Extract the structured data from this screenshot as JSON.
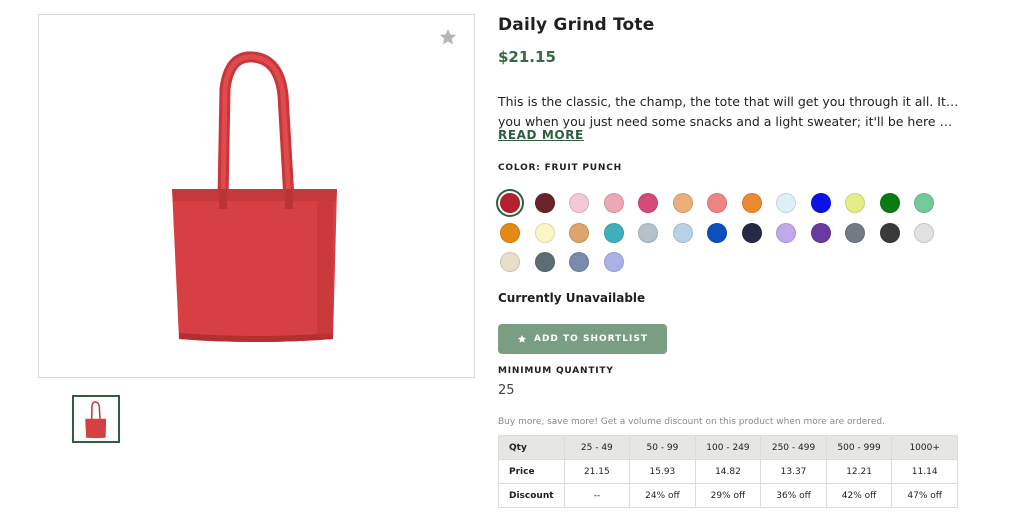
{
  "product": {
    "title": "Daily Grind Tote",
    "price": "$21.15",
    "description_lines": [
      "This is the classic, the champ, the tote that will get you through it all. It'll be here for",
      "you when you just need some snacks and a light sweater; it'll be here when you hav..."
    ],
    "read_more_label": "READ MORE",
    "color_label": "COLOR: FRUIT PUNCH",
    "favorite_icon": "star-icon",
    "product_color": "#d43c40",
    "swatches": [
      "#b5212f",
      "#6b2229",
      "#f5c8d6",
      "#eea8b4",
      "#d44a78",
      "#eab078",
      "#ef8484",
      "#ec8a2e",
      "#dff1f8",
      "#0a12e8",
      "#e3ef86",
      "#0a7a12",
      "#74c99a",
      "#e58a14",
      "#fbf6c6",
      "#dda46c",
      "#3db0bc",
      "#b4c2cc",
      "#b8d2ea",
      "#0c4ebe",
      "#262a46",
      "#c2a8ea",
      "#6a3aa0",
      "#727c86",
      "#3a3a3a",
      "#e2e2e2",
      "#e8e0c6",
      "#5c6e74",
      "#7a8aac",
      "#a8b2e6"
    ],
    "selected_swatch": 0,
    "availability": "Currently Unavailable",
    "shortlist_label": "ADD TO SHORTLIST",
    "shortlist_icon": "star-icon",
    "button_color": "#7a9e82",
    "min_quantity_label": "MINIMUM QUANTITY",
    "min_quantity_value": "25",
    "volume_note": "Buy more, save more! Get a volume discount on this product when more are ordered.",
    "accent_color": "#2f6b43"
  },
  "pricing_table": {
    "headers": [
      "Qty",
      "25 - 49",
      "50 - 99",
      "100 - 249",
      "250 - 499",
      "500 - 999",
      "1000+"
    ],
    "rows": [
      [
        "Price",
        "21.15",
        "15.93",
        "14.82",
        "13.37",
        "12.21",
        "11.14"
      ],
      [
        "Discount",
        "--",
        "24% off",
        "29% off",
        "36% off",
        "42% off",
        "47% off"
      ]
    ]
  }
}
